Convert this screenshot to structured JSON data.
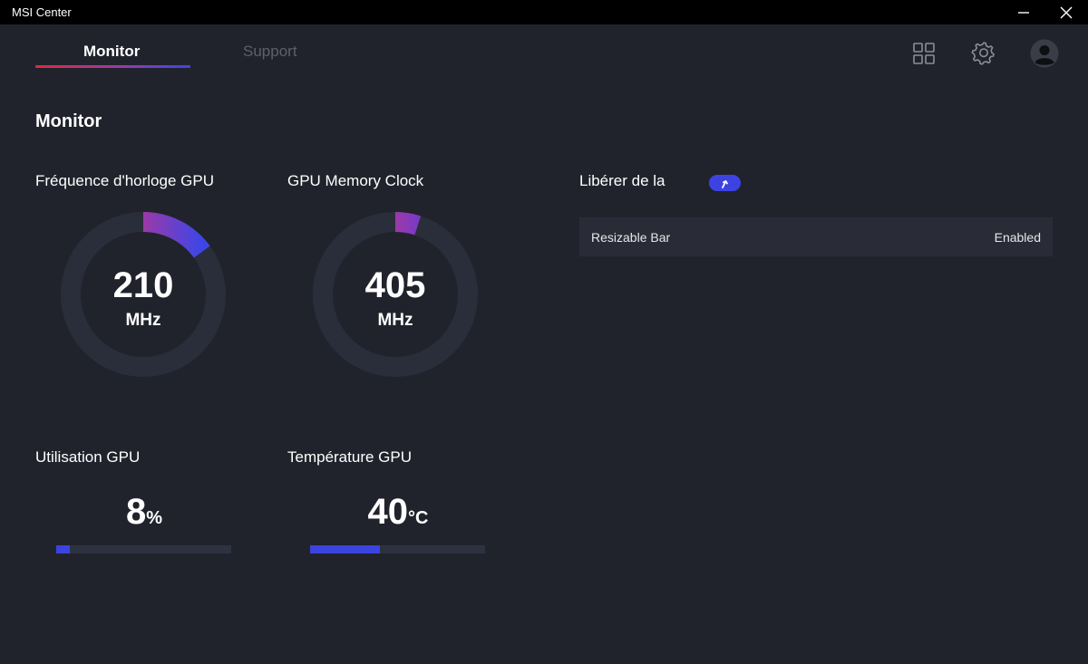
{
  "window": {
    "title": "MSI Center"
  },
  "tabs": [
    {
      "label": "Monitor",
      "active": true
    },
    {
      "label": "Support",
      "active": false
    }
  ],
  "header_icons": [
    "grid-icon",
    "gear-icon",
    "avatar-icon"
  ],
  "section": {
    "title": "Monitor"
  },
  "gpu_clock": {
    "label": "Fréquence d'horloge GPU",
    "value": "210",
    "unit": "MHz",
    "gauge_level": 0.15
  },
  "memory_clock": {
    "label": "GPU Memory Clock",
    "value": "405",
    "unit": "MHz",
    "gauge_level": 0.05
  },
  "gpu_usage": {
    "label": "Utilisation GPU",
    "value": "8",
    "unit": "%",
    "level": 0.08
  },
  "gpu_temp": {
    "label": "Température GPU",
    "value": "40",
    "unit": "°C",
    "level": 0.4
  },
  "release": {
    "label": "Libérer de la",
    "toggle_icon": "arrow-up-icon"
  },
  "info_rows": [
    {
      "key": "Resizable Bar",
      "value": "Enabled"
    }
  ],
  "colors": {
    "background": "#21232c",
    "accent_blue": "#3b43e0",
    "accent_red": "#e0293f",
    "accent_purple": "#9b3aa8",
    "track": "#2e3240"
  }
}
